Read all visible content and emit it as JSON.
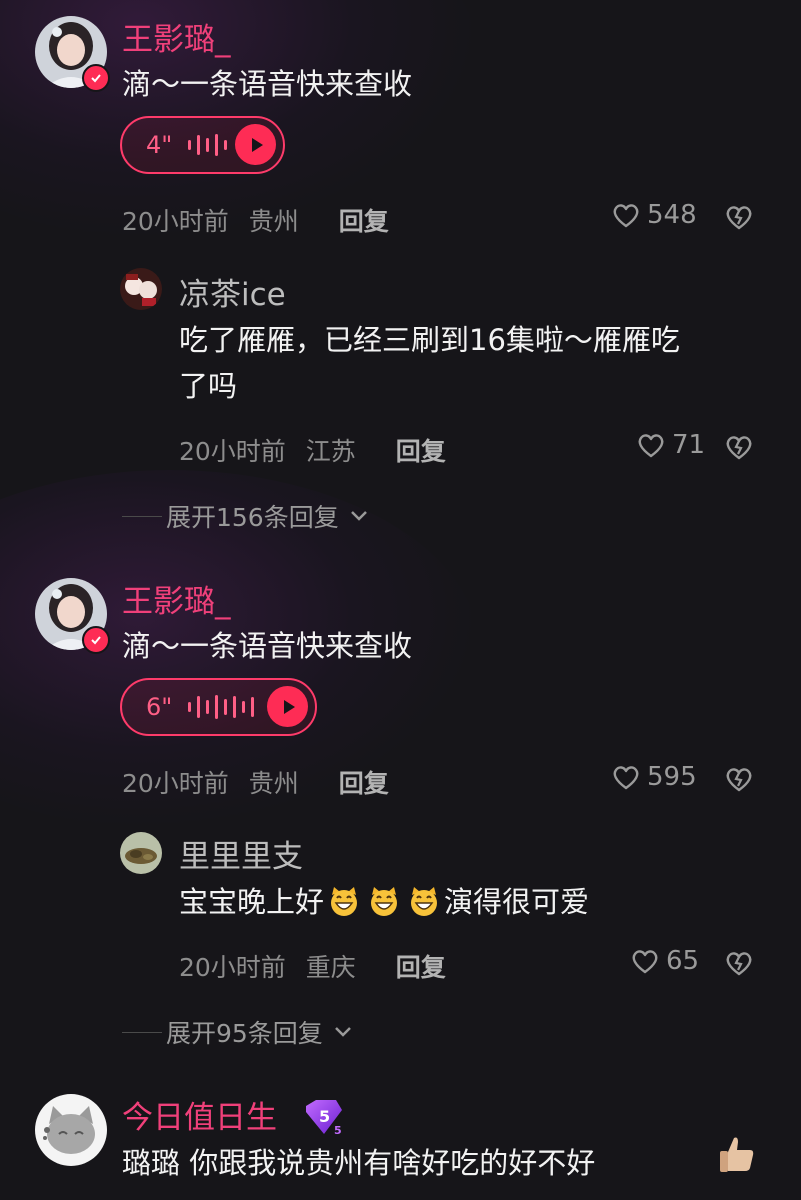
{
  "comments": [
    {
      "user": "王影璐_",
      "text": "滴～一条语音快来查收",
      "voice_duration": "4\"",
      "time": "20小时前",
      "location": "贵州",
      "reply_label": "回复",
      "likes": "548",
      "reply": {
        "user": "凉茶ice",
        "text_line1": "吃了雁雁，已经三刷到16集啦～雁雁吃",
        "text_line2": "了吗",
        "time": "20小时前",
        "location": "江苏",
        "reply_label": "回复",
        "likes": "71"
      },
      "expand_label": "展开156条回复"
    },
    {
      "user": "王影璐_",
      "text": "滴～一条语音快来查收",
      "voice_duration": "6\"",
      "time": "20小时前",
      "location": "贵州",
      "reply_label": "回复",
      "likes": "595",
      "reply": {
        "user": "里里里支",
        "text_start": "宝宝晚上好",
        "text_end": "演得很可爱",
        "time": "20小时前",
        "location": "重庆",
        "reply_label": "回复",
        "likes": "65"
      },
      "expand_label": "展开95条回复"
    },
    {
      "user": "今日值日生",
      "level": "5",
      "text": "璐璐 你跟我说贵州有啥好吃的好不好"
    }
  ],
  "colors": {
    "background": "#161519",
    "accent_pink": "#fe2c55",
    "creator_name": "#f0407a",
    "meta_gray": "#8d8d8d"
  },
  "icons": [
    "verified-icon",
    "voice-wave-icon",
    "play-icon",
    "heart-icon",
    "dislike-icon",
    "chevron-down-icon",
    "grin-cat-emoji",
    "level-badge-icon",
    "thumbs-up-icon"
  ]
}
